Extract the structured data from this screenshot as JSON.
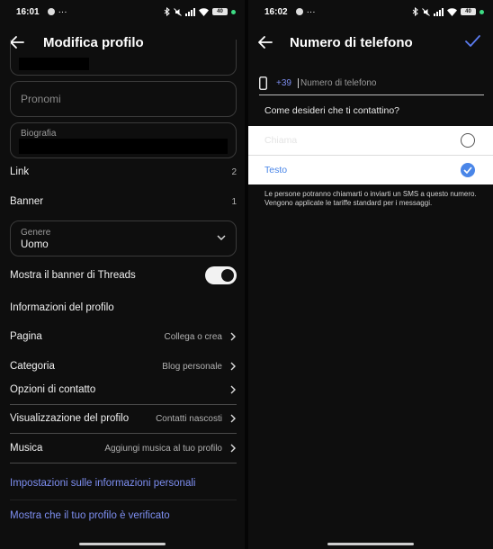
{
  "left": {
    "status": {
      "time": "16:01",
      "dots": "···",
      "battery": "40"
    },
    "title": "Modifica profilo",
    "pronouns_placeholder": "Pronomi",
    "bio_label": "Biografia",
    "link": {
      "label": "Link",
      "value": "2"
    },
    "banner": {
      "label": "Banner",
      "value": "1"
    },
    "gender": {
      "label": "Genere",
      "value": "Uomo"
    },
    "threads_toggle": {
      "label": "Mostra il banner di Threads",
      "on": true
    },
    "section_title": "Informazioni del profilo",
    "rows": [
      {
        "label": "Pagina",
        "value": "Collega o crea"
      },
      {
        "label": "Categoria",
        "value": "Blog personale"
      },
      {
        "label": "Opzioni di contatto",
        "value": ""
      },
      {
        "label": "Visualizzazione del profilo",
        "value": "Contatti nascosti"
      },
      {
        "label": "Musica",
        "value": "Aggiungi musica al tuo profilo"
      }
    ],
    "links": [
      "Impostazioni sulle informazioni personali",
      "Mostra che il tuo profilo è verificato"
    ]
  },
  "right": {
    "status": {
      "time": "16:02",
      "dots": "···",
      "battery": "40"
    },
    "title": "Numero di telefono",
    "country_code": "+39",
    "phone_placeholder": "Numero di telefono",
    "question": "Come desideri che ti contattino?",
    "options": [
      {
        "label": "Chiama",
        "selected": false
      },
      {
        "label": "Testo",
        "selected": true
      }
    ],
    "hint": "Le persone potranno chiamarti o inviarti un SMS a questo numero. Vengono applicate le tariffe standard per i messaggi."
  },
  "colors": {
    "accent": "#7d8ef0",
    "selected": "#4a86e8",
    "background": "#0e0e0e"
  }
}
